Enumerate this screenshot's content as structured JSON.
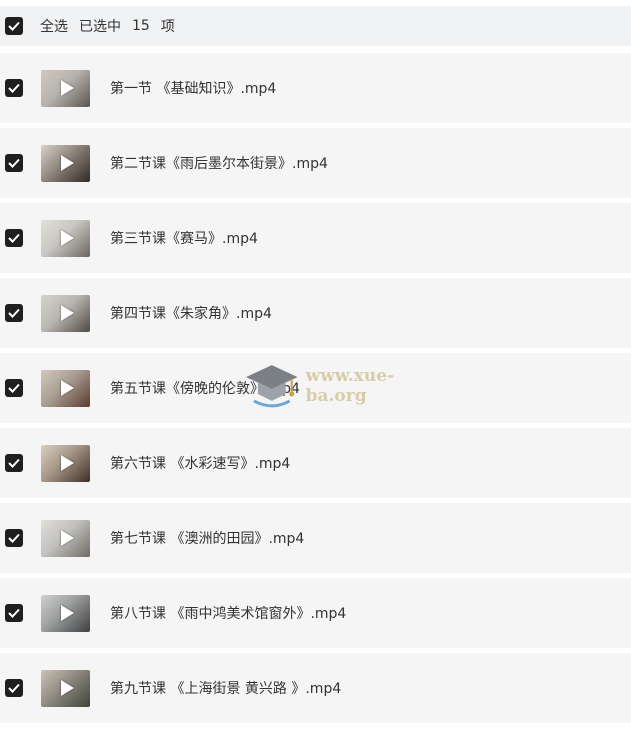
{
  "header": {
    "select_all_label": "全选",
    "selected_label": "已选中",
    "selected_count": "15",
    "unit_label": "项"
  },
  "files": [
    {
      "title": "第一节 《基础知识》.mp4",
      "thumb_colors": [
        "#b7b3ad",
        "#5a5550",
        "#cfc8bf"
      ]
    },
    {
      "title": "第二节课《雨后墨尔本街景》.mp4",
      "thumb_colors": [
        "#8f867c",
        "#2f2a26",
        "#d8d2c9"
      ]
    },
    {
      "title": "第三节课《赛马》.mp4",
      "thumb_colors": [
        "#c8c6c2",
        "#6a6560",
        "#e2dfda"
      ]
    },
    {
      "title": "第四节课《朱家角》.mp4",
      "thumb_colors": [
        "#b9b6b1",
        "#4d4844",
        "#d6d2cc"
      ]
    },
    {
      "title": "第五节课《傍晚的伦敦》.mp4",
      "thumb_colors": [
        "#a79d92",
        "#5e3a2e",
        "#d3c9bd"
      ]
    },
    {
      "title": "第六节课 《水彩速写》.mp4",
      "thumb_colors": [
        "#a49686",
        "#3e2f28",
        "#d9cfc4"
      ]
    },
    {
      "title": "第七节课 《澳洲的田园》.mp4",
      "thumb_colors": [
        "#c2c1be",
        "#6f6a66",
        "#e0ddd9"
      ]
    },
    {
      "title": "第八节课 《雨中鸿美术馆窗外》.mp4",
      "thumb_colors": [
        "#9b9c9c",
        "#3d3f41",
        "#cfd1d1"
      ]
    },
    {
      "title": "第九节课 《上海街景 黄兴路 》.mp4",
      "thumb_colors": [
        "#8f8a80",
        "#3e4435",
        "#c9c3b8"
      ]
    }
  ],
  "watermark": {
    "text": "www.xue-ba.org",
    "icon": "graduation-cap-icon"
  },
  "colors": {
    "checkbox": "#1f1f1f",
    "row_background": "#f5f5f5",
    "header_background": "#f1f2f4",
    "text": "#333333"
  }
}
